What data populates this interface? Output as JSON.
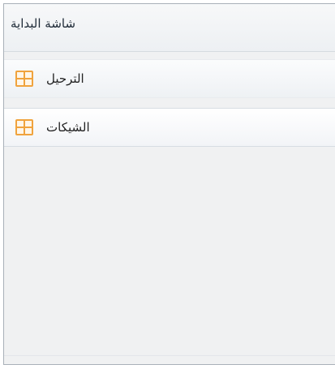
{
  "window": {
    "panel_title": "شاشة البداية"
  },
  "items": [
    {
      "label": "الترحيل",
      "icon": "dashboard-icon"
    },
    {
      "label": "الشيكات",
      "icon": "dashboard-icon"
    }
  ]
}
